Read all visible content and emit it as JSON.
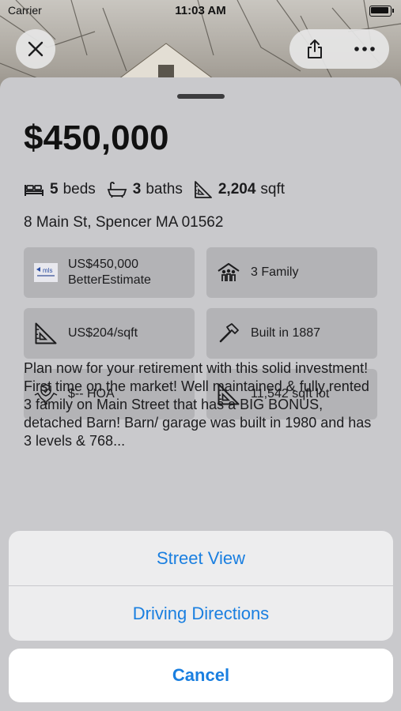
{
  "status_bar": {
    "carrier": "Carrier",
    "time": "11:03 AM"
  },
  "header": {
    "close_icon": "close-icon",
    "share_icon": "share-icon",
    "more_icon": "more-icon"
  },
  "listing": {
    "price": "$450,000",
    "beds_count": "5",
    "beds_label": "beds",
    "baths_count": "3",
    "baths_label": "baths",
    "sqft_count": "2,204",
    "sqft_label": "sqft",
    "address": "8 Main St, Spencer MA 01562"
  },
  "tiles": [
    {
      "icon": "mls-logo",
      "line1": "US$450,000",
      "line2": "BetterEstimate"
    },
    {
      "icon": "family-icon",
      "line1": "3 Family"
    },
    {
      "icon": "ruler-triangle-icon",
      "line1": "US$204/sqft"
    },
    {
      "icon": "hammer-icon",
      "line1": "Built in 1887"
    },
    {
      "icon": "hoa-hands-icon",
      "line1": "$-- HOA"
    },
    {
      "icon": "ruler-triangle-icon",
      "line1": "11,542 sqft lot"
    }
  ],
  "mls_logo_text": "mls",
  "description": "Plan now for your retirement with this solid investment! First time on the market! Well maintained & fully rented 3 family on Main Street that has a  BIG BONUS, detached Barn!  Barn/ garage was built in 1980 and has 3 levels & 768...",
  "action_sheet": {
    "street_view": "Street View",
    "driving_directions": "Driving Directions",
    "cancel": "Cancel"
  },
  "colors": {
    "accent": "#1a7fe0",
    "sheet": "#c9c9cc",
    "tile": "#b3b3b6"
  }
}
